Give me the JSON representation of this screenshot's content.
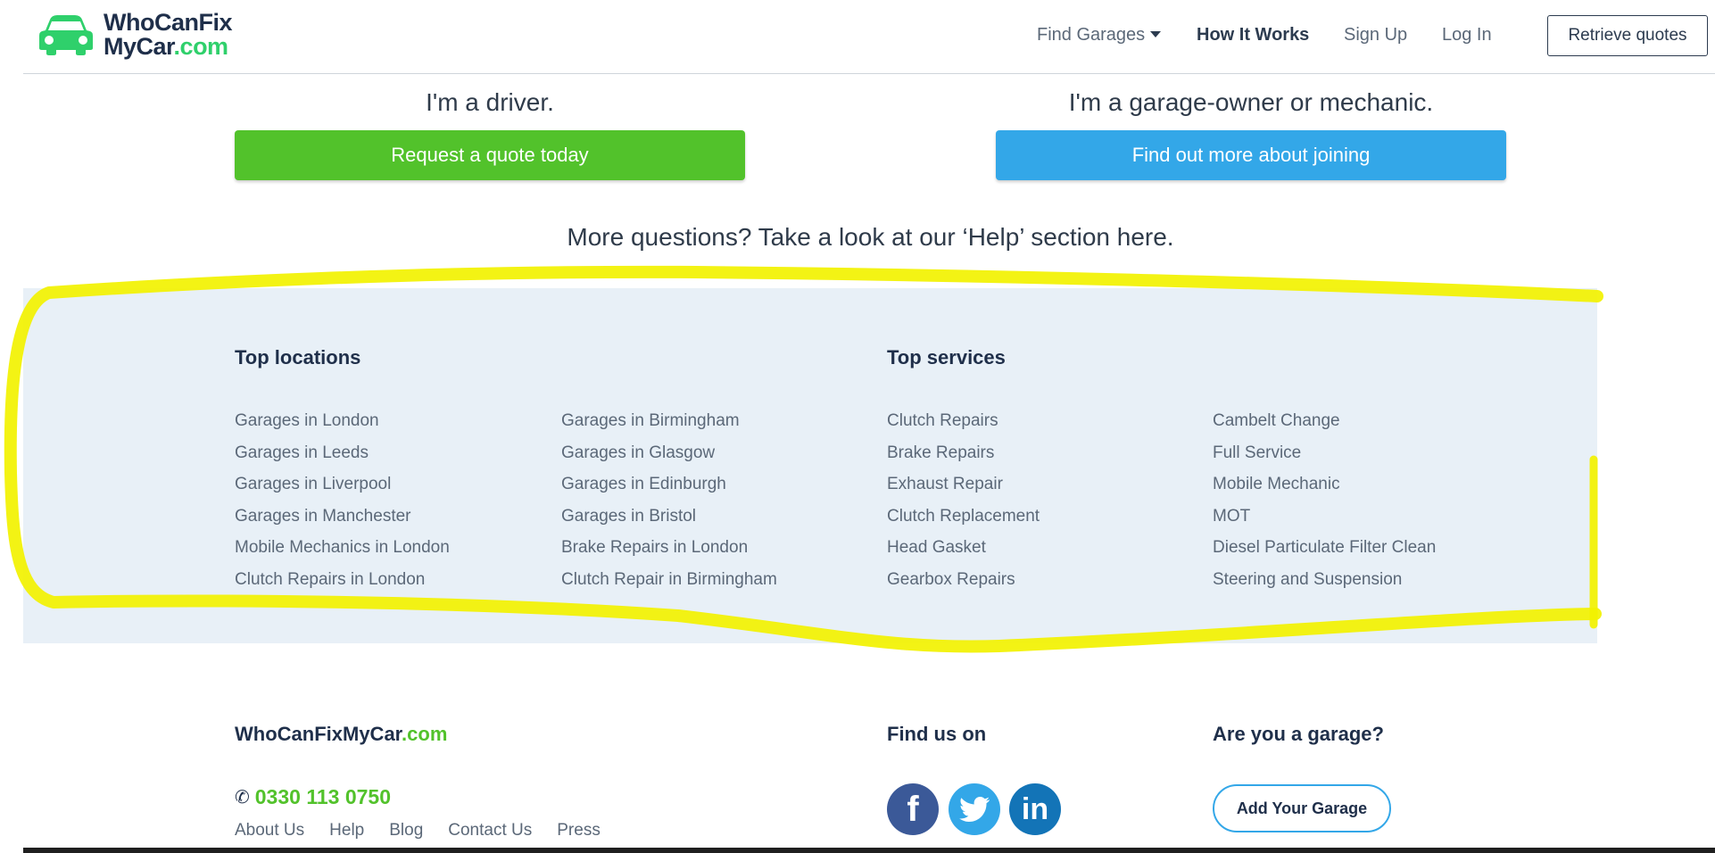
{
  "header": {
    "logo_line1": "WhoCanFix",
    "logo_line2": "MyCar",
    "logo_dotcom": ".com",
    "nav": {
      "find_garages": "Find Garages",
      "how_it_works": "How It Works",
      "sign_up": "Sign Up",
      "log_in": "Log In",
      "retrieve_quotes": "Retrieve quotes"
    }
  },
  "cta": {
    "driver_heading": "I'm a driver.",
    "driver_button": "Request a quote today",
    "garage_heading": "I'm a garage-owner or mechanic.",
    "garage_button": "Find out more about joining",
    "help_text": "More questions? Take a look at our ‘Help’ section here."
  },
  "links_band": {
    "locations_title": "Top locations",
    "services_title": "Top services",
    "locations_col1": [
      "Garages in London",
      "Garages in Leeds",
      "Garages in Liverpool",
      "Garages in Manchester",
      "Mobile Mechanics in London",
      "Clutch Repairs in London"
    ],
    "locations_col2": [
      "Garages in Birmingham",
      "Garages in Glasgow",
      "Garages in Edinburgh",
      "Garages in Bristol",
      "Brake Repairs in London",
      "Clutch Repair in Birmingham"
    ],
    "services_col1": [
      "Clutch Repairs",
      "Brake Repairs",
      "Exhaust Repair",
      "Clutch Replacement",
      "Head Gasket",
      "Gearbox Repairs"
    ],
    "services_col2": [
      "Cambelt Change",
      "Full Service",
      "Mobile Mechanic",
      "MOT",
      "Diesel Particulate Filter Clean",
      "Steering and Suspension"
    ],
    "highlight_color": "#f2f200"
  },
  "footer": {
    "brand": "WhoCanFixMyCar",
    "brand_dotcom": ".com",
    "phone": "0330 113 0750",
    "links": [
      "About Us",
      "Help",
      "Blog",
      "Contact Us",
      "Press"
    ],
    "find_us_title": "Find us on",
    "social": [
      "facebook-icon",
      "twitter-icon",
      "linkedin-icon"
    ],
    "garage_title": "Are you a garage?",
    "add_garage_button": "Add Your Garage"
  },
  "colors": {
    "green": "#52c22b",
    "blue": "#33a7e8",
    "navy": "#1f2f4a",
    "band_bg": "#e8f0f7"
  }
}
